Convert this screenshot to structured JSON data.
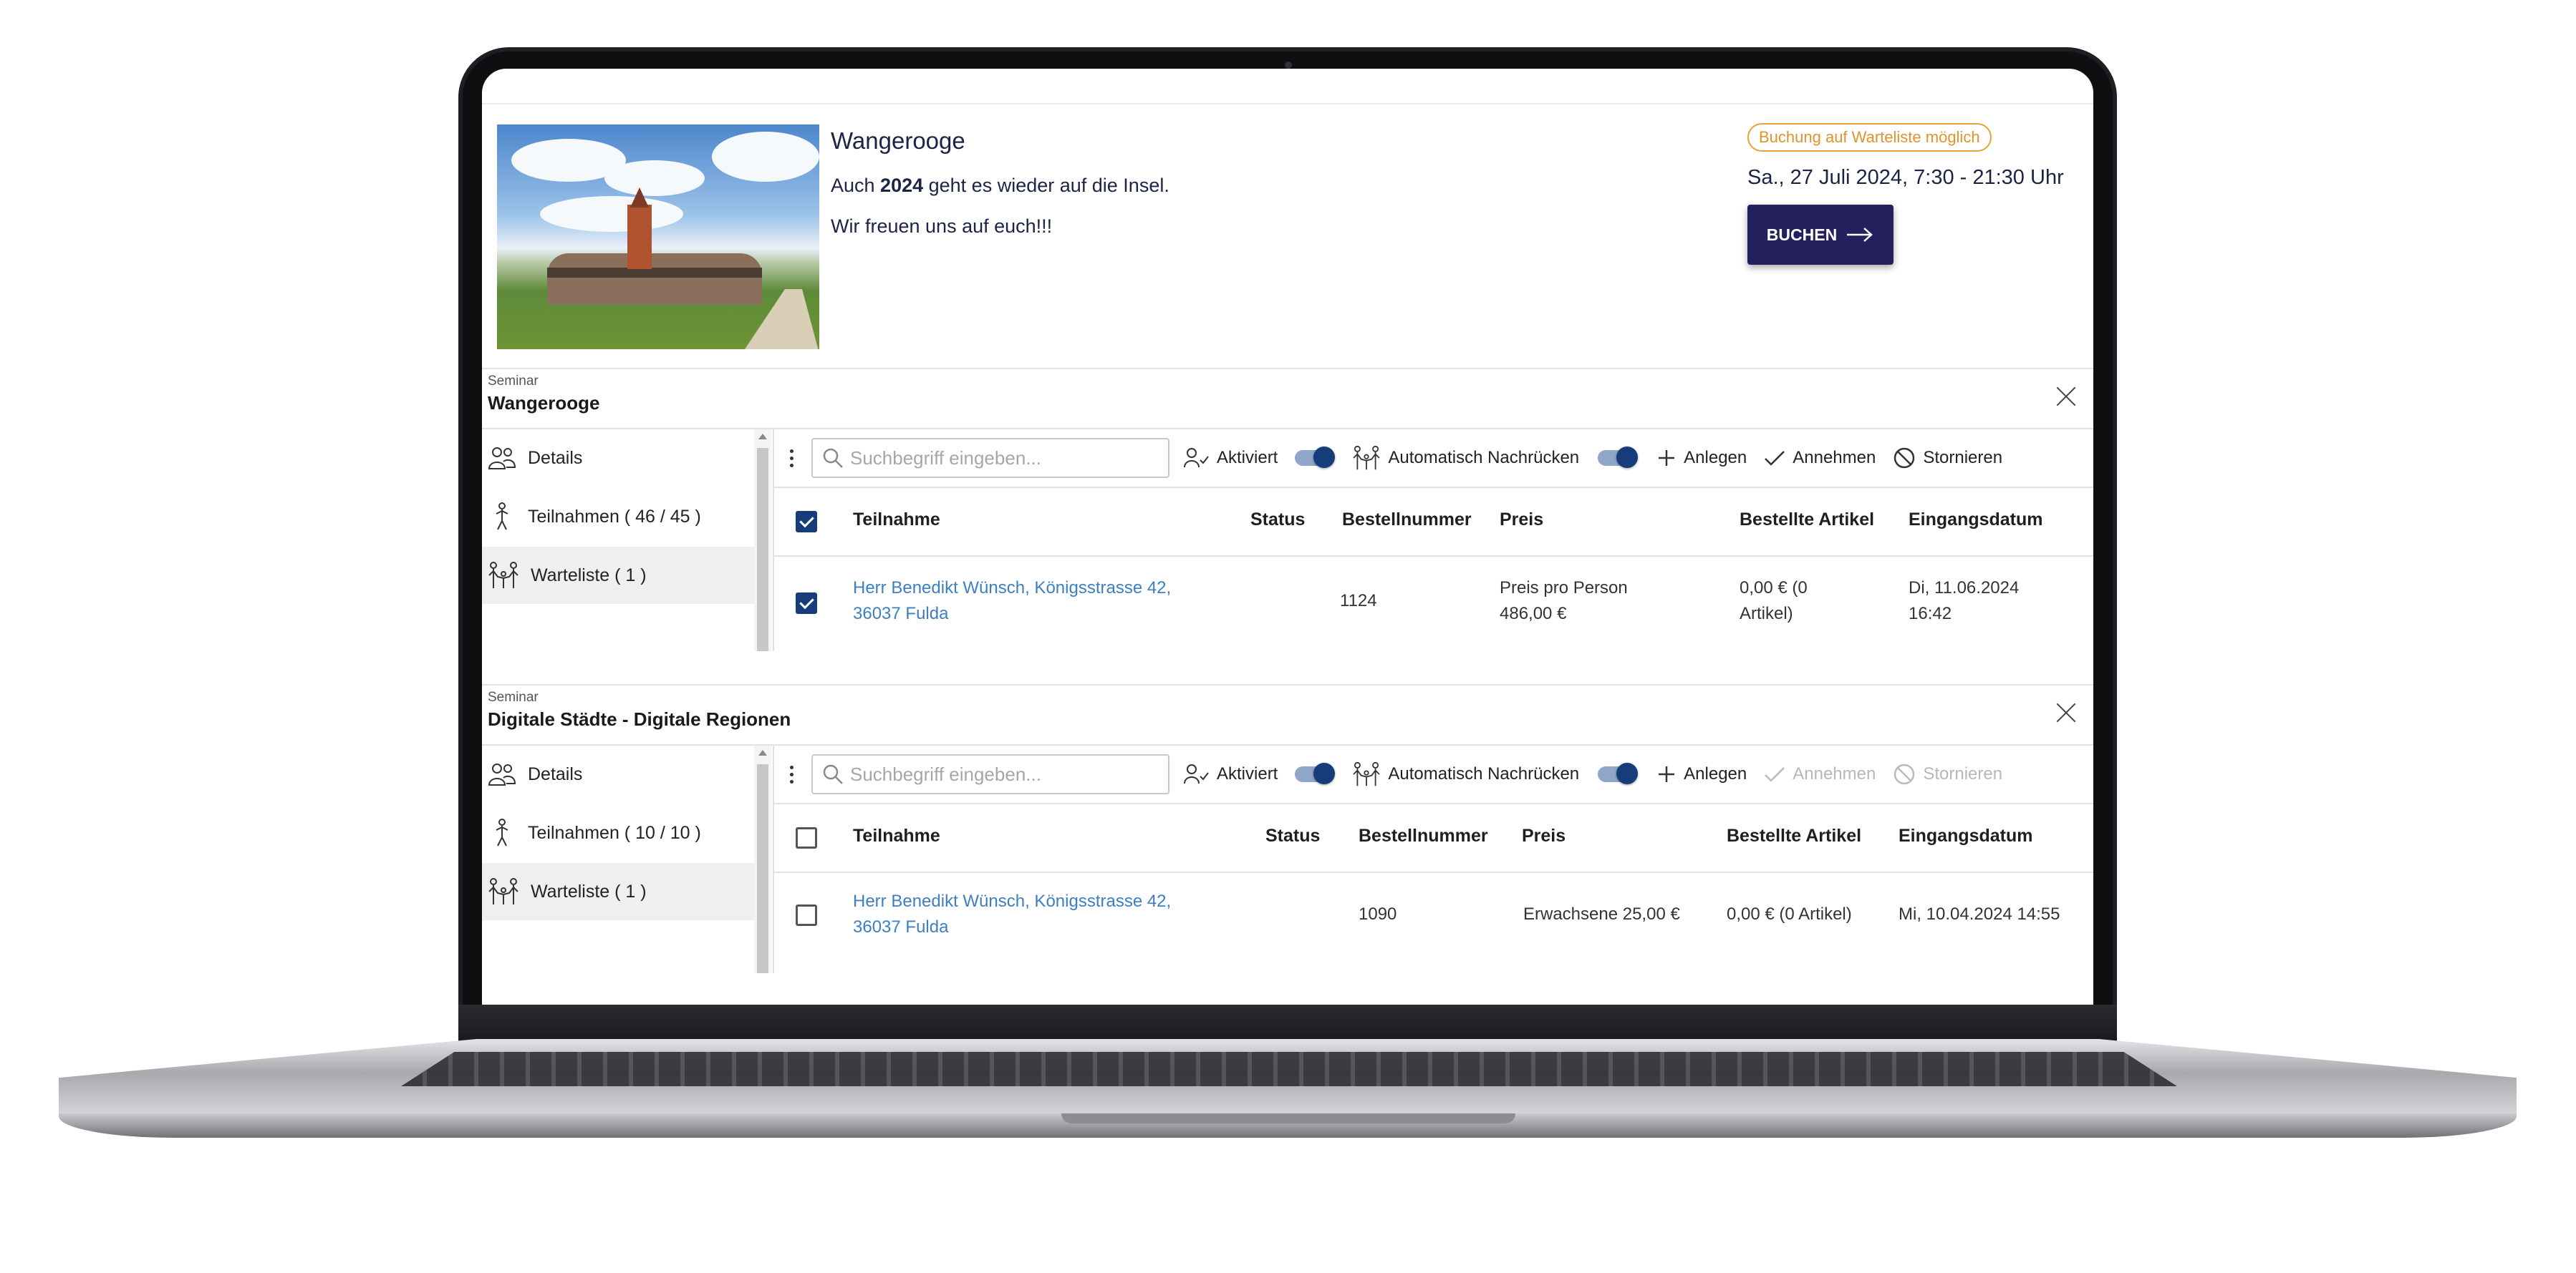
{
  "event": {
    "title": "Wangerooge",
    "line1_pre": "Auch ",
    "line1_bold": "2024",
    "line1_post": " geht es wieder auf die Insel.",
    "line2": "Wir freuen uns auf euch!!!",
    "waitlist_badge": "Buchung auf Warteliste möglich",
    "date": "Sa., 27 Juli 2024, 7:30 - 21:30 Uhr",
    "book_label": "BUCHEN"
  },
  "panels": [
    {
      "label": "Seminar",
      "title": "Wangerooge",
      "side": [
        "Details",
        "Teilnahmen ( 46 / 45 )",
        "Warteliste ( 1 )"
      ],
      "search_placeholder": "Suchbegriff eingeben...",
      "toolbar": {
        "activated": "Aktiviert",
        "auto_advance": "Automatisch Nachrücken",
        "create": "Anlegen",
        "accept": "Annehmen",
        "cancel": "Stornieren",
        "accept_enabled": true,
        "cancel_enabled": true
      },
      "columns": [
        "Teilnahme",
        "Status",
        "Bestellnummer",
        "Preis",
        "Bestellte Artikel",
        "Eingangsdatum"
      ],
      "header_checked": true,
      "rows": [
        {
          "checked": true,
          "participant": "Herr Benedikt Wünsch, Königsstrasse 42,",
          "participant2": "36037 Fulda",
          "status": "",
          "order_no": "1124",
          "price": "Preis pro Person",
          "price2": "486,00 €",
          "articles": "0,00 € (0",
          "articles2": "Artikel)",
          "date": "Di, 11.06.2024",
          "date2": "16:42"
        }
      ]
    },
    {
      "label": "Seminar",
      "title": "Digitale Städte - Digitale Regionen",
      "side": [
        "Details",
        "Teilnahmen ( 10 / 10 )",
        "Warteliste ( 1 )"
      ],
      "search_placeholder": "Suchbegriff eingeben...",
      "toolbar": {
        "activated": "Aktiviert",
        "auto_advance": "Automatisch Nachrücken",
        "create": "Anlegen",
        "accept": "Annehmen",
        "cancel": "Stornieren",
        "accept_enabled": false,
        "cancel_enabled": false
      },
      "columns": [
        "Teilnahme",
        "Status",
        "Bestellnummer",
        "Preis",
        "Bestellte Artikel",
        "Eingangsdatum"
      ],
      "header_checked": false,
      "rows": [
        {
          "checked": false,
          "participant": "Herr Benedikt Wünsch, Königsstrasse 42,",
          "participant2": "36037 Fulda",
          "status": "",
          "order_no": "1090",
          "price": "Erwachsene 25,00 €",
          "price2": "",
          "articles": "0,00 € (0 Artikel)",
          "articles2": "",
          "date": "Mi, 10.04.2024 14:55",
          "date2": ""
        }
      ]
    }
  ],
  "colors": {
    "primary": "#24205e",
    "toggle": "#163d7a",
    "link": "#3d7fc1",
    "badge": "#e9a03b"
  }
}
